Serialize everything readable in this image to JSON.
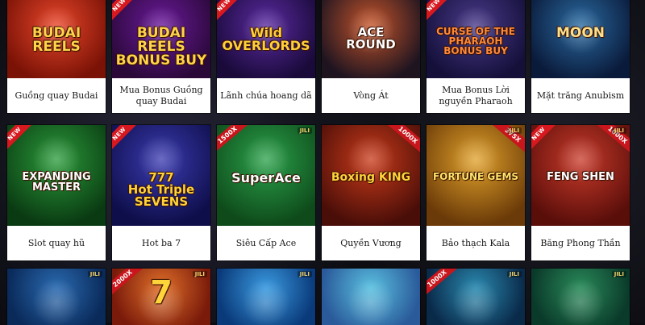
{
  "games": [
    {
      "caption": "Guồng quay Budai",
      "logo": "BUDAI\nREELS",
      "new": false,
      "multiplier": "",
      "jili": false,
      "bg": [
        "#e8462a",
        "#7a1206"
      ],
      "logo_color": "#ffd34a"
    },
    {
      "caption": "Mua Bonus Guồng quay Budai",
      "logo": "BUDAI\nREELS\nBONUS BUY",
      "new": true,
      "multiplier": "",
      "jili": false,
      "bg": [
        "#6a1a9a",
        "#2a0838"
      ],
      "logo_color": "#ffd34a"
    },
    {
      "caption": "Lãnh chúa hoang dã",
      "logo": "Wild\nOVERLORDS",
      "new": true,
      "multiplier": "",
      "jili": false,
      "bg": [
        "#5a2aa0",
        "#1a0a3a"
      ],
      "logo_color": "#ffcf3a"
    },
    {
      "caption": "Vòng Át",
      "logo": "ACE\nROUND",
      "new": false,
      "multiplier": "",
      "jili": false,
      "bg": [
        "#c4542a",
        "#1e1420"
      ],
      "logo_color": "#ffffff"
    },
    {
      "caption": "Mua Bonus Lời nguyền Pharaoh",
      "logo": "CURSE OF THE\nPHARAOH\nBONUS BUY",
      "new": true,
      "multiplier": "",
      "jili": false,
      "bg": [
        "#4a3a8a",
        "#14103a"
      ],
      "logo_color": "#ff8a3a"
    },
    {
      "caption": "Mặt trăng Anubism",
      "logo": "MOON",
      "new": false,
      "multiplier": "",
      "jili": false,
      "bg": [
        "#2a6aa0",
        "#0a1a3a"
      ],
      "logo_color": "#ffe08a"
    },
    {
      "caption": "Slot quay hũ",
      "logo": "EXPANDING\nMASTER",
      "new": true,
      "multiplier": "",
      "jili": false,
      "bg": [
        "#2a9a3a",
        "#0a3a12"
      ],
      "logo_color": "#ffffff"
    },
    {
      "caption": "Hot ba 7",
      "logo": "777\nHot Triple\nSEVENS",
      "new": true,
      "multiplier": "",
      "jili": false,
      "bg": [
        "#3a3ab0",
        "#0e0e4a"
      ],
      "logo_color": "#ffd23a"
    },
    {
      "caption": "Siêu Cấp Ace",
      "logo": "SuperAce",
      "new": false,
      "multiplier": "1500X",
      "jili": true,
      "bg": [
        "#2aa04a",
        "#0e4a1a"
      ],
      "logo_color": "#ffffff"
    },
    {
      "caption": "Quyền Vương",
      "logo": "Boxing KING",
      "new": false,
      "multiplier": "1000X",
      "jili": false,
      "bg": [
        "#c83a1a",
        "#4a0e08"
      ],
      "logo_color": "#ffd33a"
    },
    {
      "caption": "Bảo thạch Kala",
      "logo": "FORTUNE GEMS",
      "new": false,
      "multiplier": "375X",
      "jili": true,
      "bg": [
        "#e0a02a",
        "#6a3a08"
      ],
      "logo_color": "#ffe56a"
    },
    {
      "caption": "Băng Phong Thần",
      "logo": "FENG SHEN",
      "new": true,
      "multiplier": "1000X",
      "jili": true,
      "bg": [
        "#c83a2a",
        "#5a0e0a"
      ],
      "logo_color": "#ffffff"
    },
    {
      "caption": "",
      "logo": "",
      "new": false,
      "multiplier": "",
      "jili": true,
      "bg": [
        "#2a6ab0",
        "#0a2a5a"
      ],
      "logo_color": "#ffffff"
    },
    {
      "caption": "",
      "logo": "7",
      "new": false,
      "multiplier": "2000X",
      "jili": true,
      "bg": [
        "#e0702a",
        "#7a1a0a"
      ],
      "logo_color": "#ffd33a"
    },
    {
      "caption": "",
      "logo": "",
      "new": false,
      "multiplier": "",
      "jili": true,
      "bg": [
        "#3a9ae0",
        "#0a3a7a"
      ],
      "logo_color": "#ffffff"
    },
    {
      "caption": "",
      "logo": "",
      "new": false,
      "multiplier": "",
      "jili": false,
      "bg": [
        "#5ac0e0",
        "#2a5a9a"
      ],
      "logo_color": "#ffffff"
    },
    {
      "caption": "",
      "logo": "",
      "new": false,
      "multiplier": "1000X",
      "jili": true,
      "bg": [
        "#2a8ab0",
        "#0a2a4a"
      ],
      "logo_color": "#ffffff"
    },
    {
      "caption": "",
      "logo": "",
      "new": false,
      "multiplier": "",
      "jili": true,
      "bg": [
        "#2a8a5a",
        "#0a3a2a"
      ],
      "logo_color": "#ffffff"
    }
  ]
}
